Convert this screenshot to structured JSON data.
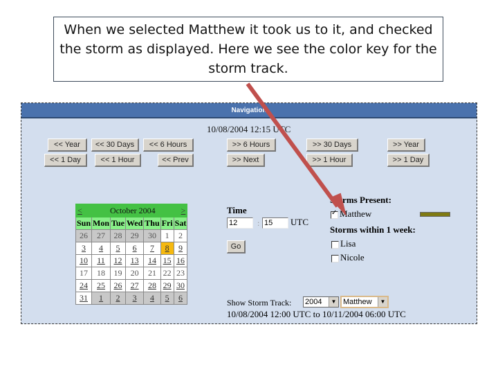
{
  "callout": {
    "text": "When we selected Matthew it took us to it, and checked the storm as displayed.  Here we see the color key for the storm track."
  },
  "navigation": {
    "header": "Navigation",
    "datetime": "10/08/2004 12:15 UTC",
    "buttons_row1": [
      "<< Year",
      "<< 30 Days",
      "<< 6 Hours",
      ">> 6 Hours",
      ">> 30 Days",
      ">> Year"
    ],
    "buttons_row2": [
      "<< 1 Day",
      "<< 1 Hour",
      "<< Prev",
      ">> Next",
      ">> 1 Hour",
      ">> 1 Day"
    ]
  },
  "calendar": {
    "prev": "<",
    "next": ">",
    "title": "October 2004",
    "weekdays": [
      "Sun",
      "Mon",
      "Tue",
      "Wed",
      "Thu",
      "Fri",
      "Sat"
    ],
    "weeks": [
      [
        "26",
        "27",
        "28",
        "29",
        "30",
        "1",
        "2"
      ],
      [
        "3",
        "4",
        "5",
        "6",
        "7",
        "8",
        "9"
      ],
      [
        "10",
        "11",
        "12",
        "13",
        "14",
        "15",
        "16"
      ],
      [
        "17",
        "18",
        "19",
        "20",
        "21",
        "22",
        "23"
      ],
      [
        "24",
        "25",
        "26",
        "27",
        "28",
        "29",
        "30"
      ],
      [
        "31",
        "1",
        "2",
        "3",
        "4",
        "5",
        "6"
      ]
    ],
    "selected_day": "8"
  },
  "time": {
    "label": "Time",
    "hour": "12",
    "separator": ":",
    "minute": "15",
    "zone": "UTC",
    "go": "Go"
  },
  "storms": {
    "present_heading": "Storms Present:",
    "present": [
      {
        "name": "Matthew",
        "checked": true,
        "track_color": "#7f7a12"
      }
    ],
    "week_heading": "Storms within 1 week:",
    "within_week": [
      {
        "name": "Lisa",
        "checked": false
      },
      {
        "name": "Nicole",
        "checked": false
      }
    ]
  },
  "track": {
    "label": "Show Storm Track:",
    "year": "2004",
    "storm": "Matthew",
    "range": "10/08/2004 12:00 UTC to 10/11/2004 06:00 UTC"
  },
  "colors": {
    "header_blue": "#4a72ad",
    "panel_bg": "#d3deee",
    "calendar_green": "#44c144",
    "today_highlight": "#f6b90f",
    "annotation_arrow": "#c0504d"
  }
}
